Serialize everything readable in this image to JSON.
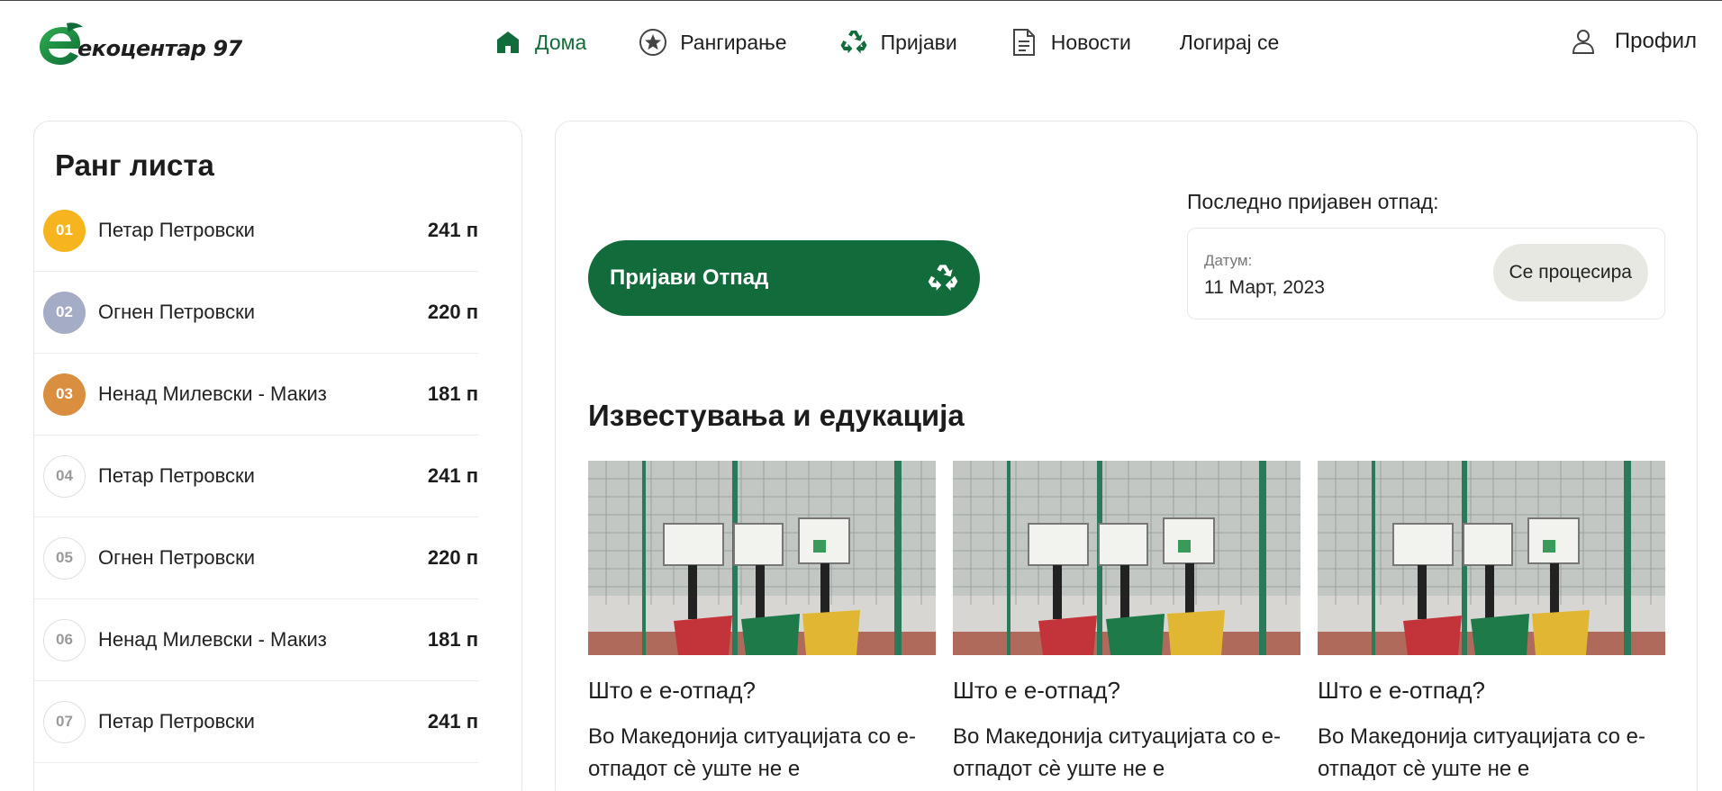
{
  "brand": {
    "name": "екоцентар 97",
    "color": "#116b3a"
  },
  "nav": {
    "items": [
      {
        "label": "Дома",
        "icon": "home-icon",
        "active": true
      },
      {
        "label": "Рангирање",
        "icon": "star-icon",
        "active": false
      },
      {
        "label": "Пријави",
        "icon": "recycle-icon",
        "active": false
      },
      {
        "label": "Новости",
        "icon": "document-icon",
        "active": false
      },
      {
        "label": "Логирај се",
        "icon": "",
        "active": false
      }
    ],
    "profile_label": "Профил"
  },
  "ranking": {
    "title": "Ранг листа",
    "rows": [
      {
        "num": "01",
        "name": "Петар Петровски",
        "points": "241 п",
        "badge_color": "#f6b51e"
      },
      {
        "num": "02",
        "name": "Огнен Петровски",
        "points": "220 п",
        "badge_color": "#a5acc5"
      },
      {
        "num": "03",
        "name": "Ненад Милевски - Макиз",
        "points": "181 п",
        "badge_color": "#d98f3f"
      },
      {
        "num": "04",
        "name": "Петар Петровски",
        "points": "241 п",
        "badge_color": ""
      },
      {
        "num": "05",
        "name": "Огнен Петровски",
        "points": "220 п",
        "badge_color": ""
      },
      {
        "num": "06",
        "name": "Ненад Милевски - Макиз",
        "points": "181 п",
        "badge_color": ""
      },
      {
        "num": "07",
        "name": "Петар Петровски",
        "points": "241 п",
        "badge_color": ""
      }
    ]
  },
  "report": {
    "button_label": "Пријави Отпад"
  },
  "last_report": {
    "label": "Последно пријавен отпад:",
    "date_label": "Датум:",
    "date": "11 Март, 2023",
    "status": "Се процесира"
  },
  "news": {
    "title": "Известувања и едукација",
    "cards": [
      {
        "title": "Што е е-отпад?",
        "text": "Во Македонија ситуацијата со е-отпадот сѐ уште не е"
      },
      {
        "title": "Што е е-отпад?",
        "text": "Во Македонија ситуацијата со е-отпадот сѐ уште не е"
      },
      {
        "title": "Што е е-отпад?",
        "text": "Во Македонија ситуацијата со е-отпадот сѐ уште не е"
      }
    ]
  }
}
